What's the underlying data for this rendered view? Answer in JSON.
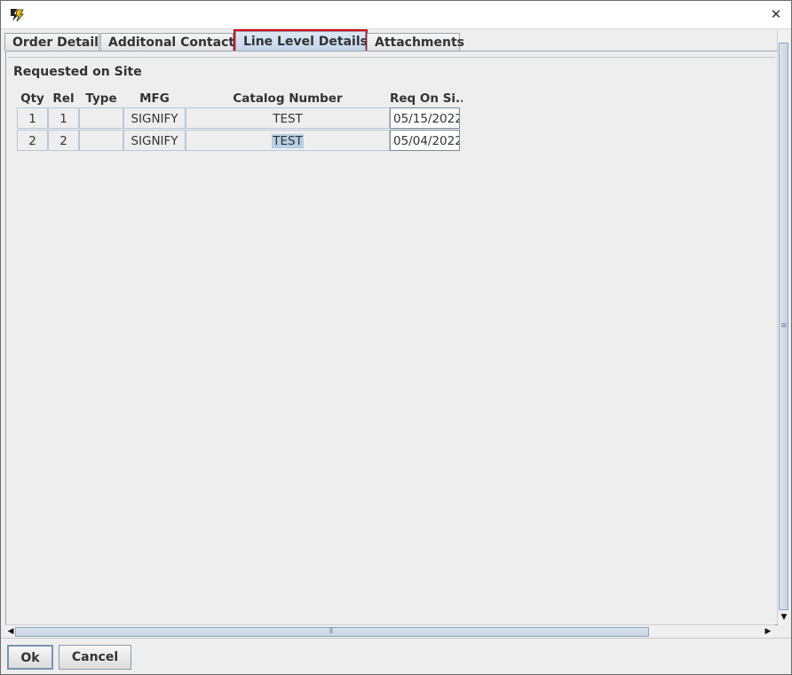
{
  "window": {
    "close_glyph": "✕",
    "icon": "app-logo-icon"
  },
  "tabs": [
    {
      "label": "Order Detail",
      "active": false
    },
    {
      "label": "Additonal Contacts",
      "active": false
    },
    {
      "label": "Line Level Details",
      "active": true
    },
    {
      "label": "Attachments",
      "active": false
    }
  ],
  "section": {
    "title": "Requested on Site"
  },
  "table": {
    "columns": [
      "Qty",
      "Rel",
      "Type",
      "MFG",
      "Catalog Number",
      "Req On Si..."
    ],
    "rows": [
      [
        "1",
        "1",
        "",
        "SIGNIFY",
        "TEST",
        "05/15/2022"
      ],
      [
        "2",
        "2",
        "",
        "SIGNIFY",
        "TEST",
        "05/04/2022"
      ]
    ]
  },
  "footer": {
    "ok_label": "Ok",
    "cancel_label": "Cancel"
  },
  "colors": {
    "active_tab_highlight": "#d0021b",
    "selection": "#b8cfe5"
  }
}
